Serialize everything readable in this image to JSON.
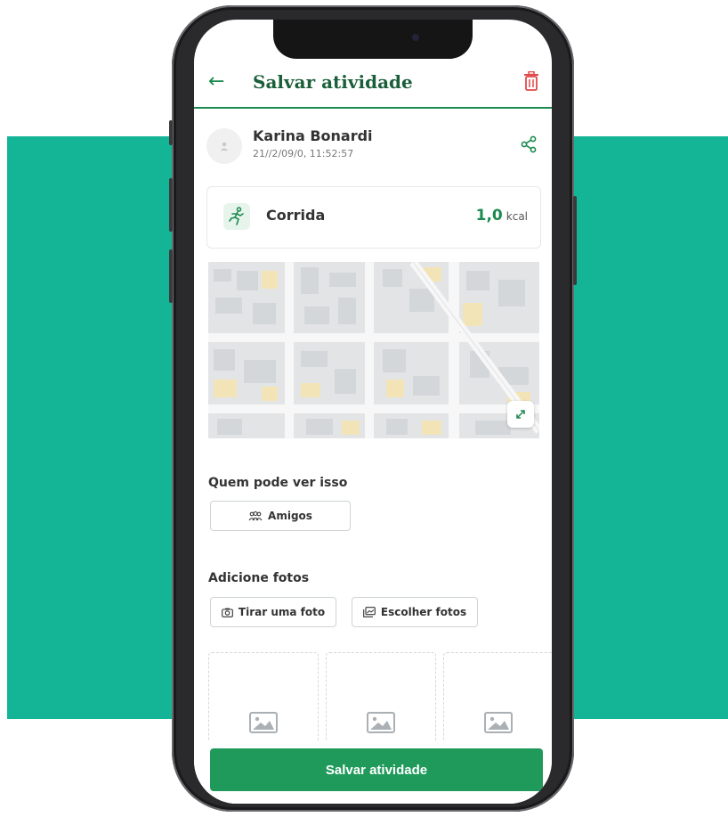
{
  "header": {
    "title": "Salvar atividade"
  },
  "user": {
    "name": "Karina Bonardi",
    "date": "21//2/09/0, 11:52:57"
  },
  "activity": {
    "name": "Corrida",
    "kcal_value": "1,0",
    "kcal_unit": "kcal"
  },
  "visibility": {
    "label": "Quem pode ver isso",
    "option": "Amigos"
  },
  "photos": {
    "label": "Adicione fotos",
    "take_photo": "Tirar uma foto",
    "choose_photos": "Escolher fotos"
  },
  "footer": {
    "save_label": "Salvar atividade"
  },
  "colors": {
    "accent": "#1b8a4f",
    "background_band": "#14b597",
    "delete": "#e04a4a"
  },
  "icons": [
    "back-arrow-icon",
    "trash-icon",
    "avatar-icon",
    "share-icon",
    "running-icon",
    "expand-icon",
    "group-icon",
    "camera-icon",
    "gallery-icon",
    "image-placeholder-icon"
  ]
}
